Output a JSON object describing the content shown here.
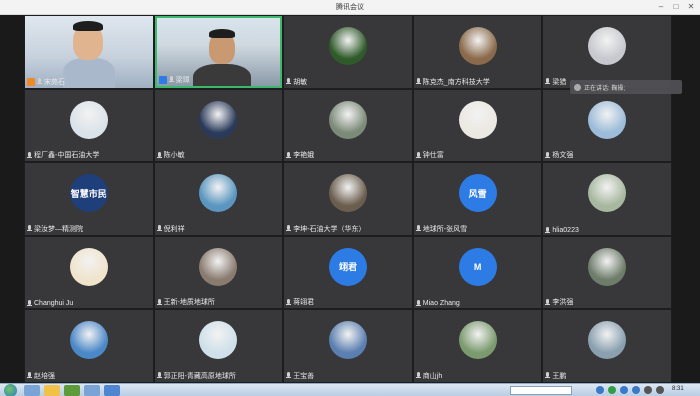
{
  "window": {
    "title": "腾讯会议"
  },
  "speaking": {
    "label": "正在讲话: 鞠操;"
  },
  "participants": [
    {
      "name": "宋苑石",
      "kind": "video",
      "host": true
    },
    {
      "name": "梁璋",
      "kind": "video",
      "host": true
    },
    {
      "name": "胡敏",
      "kind": "photo",
      "color": "#2f5a2a"
    },
    {
      "name": "陈克杰_南方科技大学",
      "kind": "photo",
      "color": "#8a6a4a"
    },
    {
      "name": "梁猎",
      "kind": "photo",
      "color": "#c7c9cf"
    },
    {
      "name": "程厂鑫-中国石油大学",
      "kind": "photo",
      "color": "#dbe3ea"
    },
    {
      "name": "陈小敏",
      "kind": "photo",
      "color": "#2a3a5a"
    },
    {
      "name": "李艳娥",
      "kind": "photo",
      "color": "#7c8a78"
    },
    {
      "name": "钟仕富",
      "kind": "photo",
      "color": "#ece8e2"
    },
    {
      "name": "杨文强",
      "kind": "photo",
      "color": "#9cbcd9"
    },
    {
      "name": "梁汝梦—精测院",
      "kind": "text",
      "text": "智慧市民",
      "color": "#1f3f7a"
    },
    {
      "name": "倪利祥",
      "kind": "photo",
      "color": "#5a96c0"
    },
    {
      "name": "李坤-石油大学（华东）",
      "kind": "photo",
      "color": "#6b5e4e"
    },
    {
      "name": "地球所-张风雪",
      "kind": "text",
      "text": "风雪",
      "color": "#2d7be5"
    },
    {
      "name": "hlia0223",
      "kind": "photo",
      "color": "#a8b8a0"
    },
    {
      "name": "Changhui Ju",
      "kind": "photo",
      "color": "#f0e4cc"
    },
    {
      "name": "王新-地质地球所",
      "kind": "photo",
      "color": "#8a7b70"
    },
    {
      "name": "蒋翊君",
      "kind": "text",
      "text": "翊君",
      "color": "#2d7be5"
    },
    {
      "name": "Miao Zhang",
      "kind": "text",
      "text": "M",
      "color": "#2d7be5"
    },
    {
      "name": "李洪强",
      "kind": "photo",
      "color": "#6e7c6a"
    },
    {
      "name": "赵培强",
      "kind": "photo",
      "color": "#4b88c8"
    },
    {
      "name": "郭正阳-青藏高原地球所",
      "kind": "photo",
      "color": "#cfe0ea"
    },
    {
      "name": "王宝善",
      "kind": "photo",
      "color": "#5b7fb0"
    },
    {
      "name": "商山jh",
      "kind": "photo",
      "color": "#7b9a6e"
    },
    {
      "name": "王鹏",
      "kind": "photo",
      "color": "#8aa0b0"
    }
  ],
  "taskbar": {
    "clock": "8:31"
  }
}
